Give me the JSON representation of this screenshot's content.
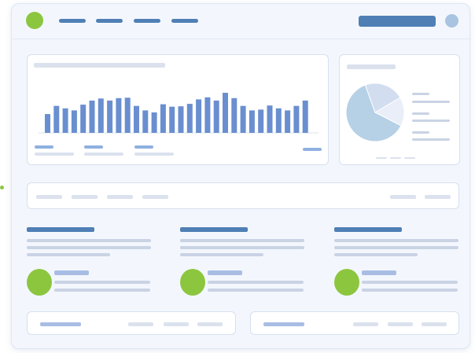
{
  "colors": {
    "accent_green": "#8cc63f",
    "primary_blue": "#4f7fb5",
    "bar_blue": "#6a8fd0",
    "pie_main": "#b6d0e6",
    "pie_secondary": "#d2ddf0",
    "pie_accent": "#e9eef8",
    "placeholder_gray": "#dbe2ee",
    "panel_background": "#f3f7fd"
  },
  "header": {
    "logo_icon": "circle-logo-icon",
    "nav_item_count": 4,
    "avatar_icon": "user-avatar-icon"
  },
  "chart_data": [
    {
      "type": "bar",
      "title": "",
      "xlabel": "",
      "ylabel": "",
      "values": [
        46,
        66,
        60,
        55,
        69,
        79,
        84,
        79,
        85,
        86,
        66,
        55,
        50,
        70,
        64,
        65,
        71,
        82,
        87,
        79,
        98,
        85,
        66,
        55,
        57,
        67,
        60,
        55,
        66,
        79
      ],
      "ylim": [
        0,
        100
      ],
      "legend": "none"
    },
    {
      "type": "pie",
      "title": "",
      "values": [
        62,
        22,
        16
      ],
      "legend": "right"
    }
  ]
}
